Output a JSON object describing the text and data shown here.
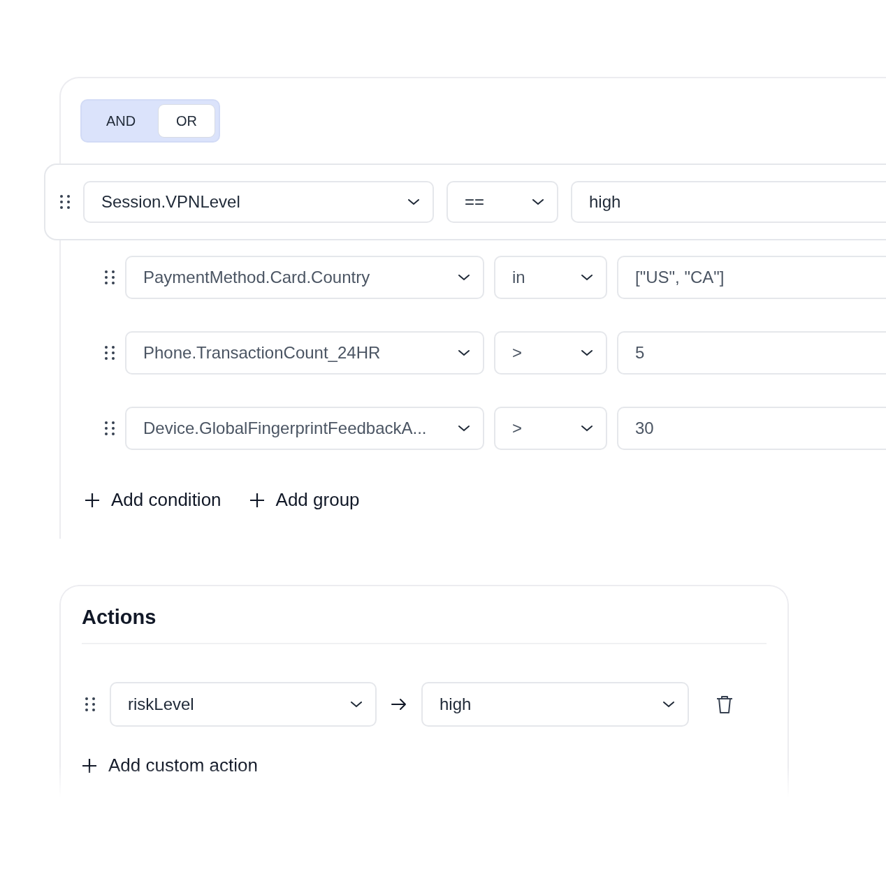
{
  "logic_toggle": [
    {
      "label": "AND",
      "selected": false
    },
    {
      "label": "OR",
      "selected": true
    }
  ],
  "conditions": [
    {
      "field": "Session.VPNLevel",
      "operator": "==",
      "value": "high",
      "lifted": true
    },
    {
      "field": "PaymentMethod.Card.Country",
      "operator": "in",
      "value": "[\"US\", \"CA\"]",
      "lifted": false
    },
    {
      "field": "Phone.TransactionCount_24HR",
      "operator": ">",
      "value": "5",
      "lifted": false
    },
    {
      "field": "Device.GlobalFingerprintFeedbackA...",
      "operator": ">",
      "value": "30",
      "lifted": false
    }
  ],
  "group_buttons": [
    "Add condition",
    "Add group"
  ],
  "actions": {
    "title": "Actions",
    "rows": [
      {
        "field": "riskLevel",
        "value": "high"
      }
    ],
    "add_button": "Add custom action"
  }
}
